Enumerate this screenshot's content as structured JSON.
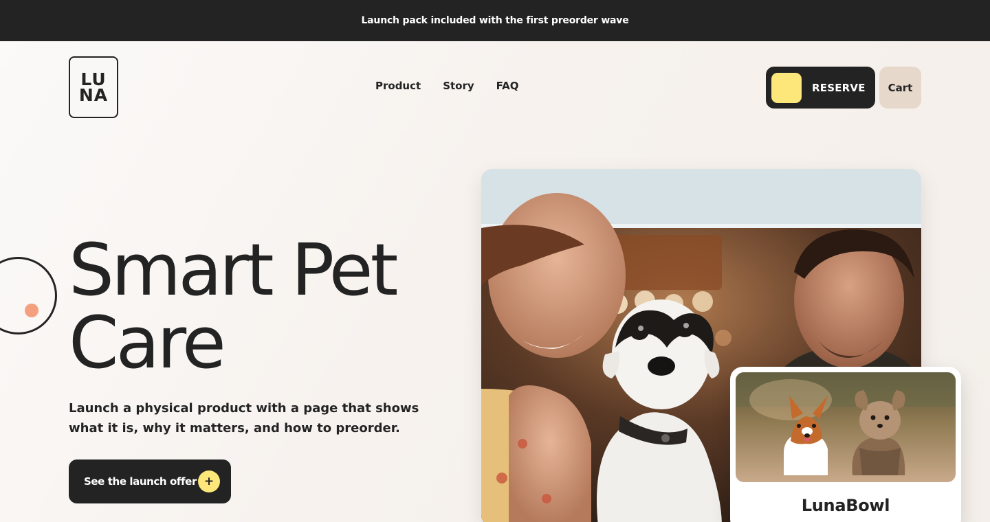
{
  "announcement": {
    "text": "Launch pack included with the first preorder wave"
  },
  "logo": {
    "line1": "LU",
    "line2": "NA"
  },
  "nav": {
    "items": [
      {
        "label": "Product"
      },
      {
        "label": "Story"
      },
      {
        "label": "FAQ"
      }
    ]
  },
  "header": {
    "reserve_label": "RESERVE",
    "cart_label": "Cart"
  },
  "hero": {
    "title_line1": "Smart Pet",
    "title_line2": "Care",
    "subtitle": "Launch a physical product with a page that shows what it is, why it matters, and how to preorder.",
    "cta_label": "See the launch offer",
    "cta_icon": "+"
  },
  "product_card": {
    "name": "LunaBowl"
  },
  "colors": {
    "dark": "#232323",
    "accent_yellow": "#fde67a",
    "accent_peach": "#f4a07e",
    "cart_bg": "#e6d8cb",
    "background": "#f7f2ee"
  }
}
